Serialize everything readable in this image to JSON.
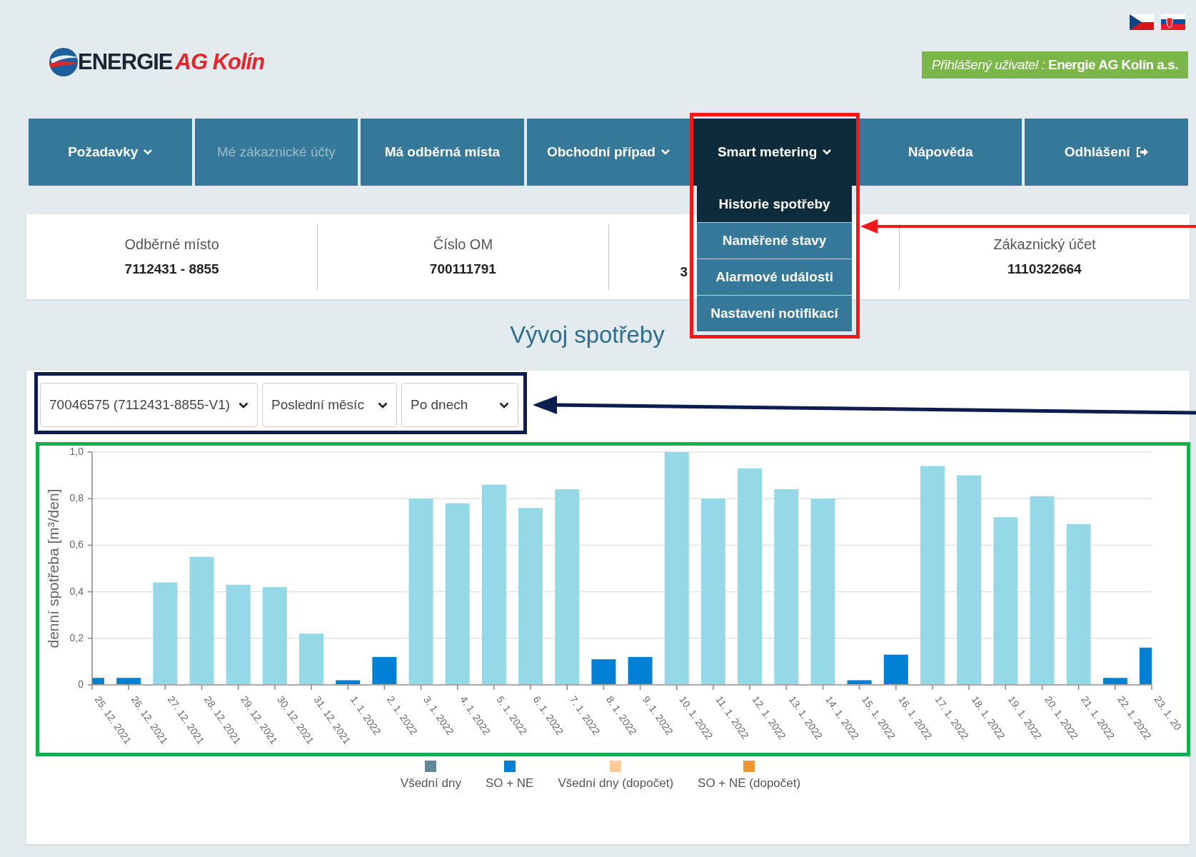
{
  "header": {
    "logo": {
      "brand": "ENERGIE",
      "city": "AG Kolín"
    },
    "user_badge": "*Přihlášený uživatel :* **Energie AG Kolín a.s.**"
  },
  "nav": [
    {
      "label": "Požadavky",
      "kind": "menu",
      "disabled": false,
      "selected": false
    },
    {
      "label": "Mé zákaznické účty",
      "kind": "link",
      "disabled": true,
      "selected": false
    },
    {
      "label": "Má odběrná místa",
      "kind": "link",
      "disabled": false,
      "selected": false
    },
    {
      "label": "Obchodní případ",
      "kind": "menu",
      "disabled": false,
      "selected": false
    },
    {
      "label": "Smart metering",
      "kind": "menu",
      "disabled": false,
      "selected": true,
      "submenu": [
        {
          "label": "Historie spotřeby",
          "selected": true
        },
        {
          "label": "Naměřené stavy",
          "selected": false
        },
        {
          "label": "Alarmové události",
          "selected": false
        },
        {
          "label": "Nastavení notifikací",
          "selected": false
        }
      ]
    },
    {
      "label": "Nápověda",
      "kind": "link",
      "disabled": false,
      "selected": false
    },
    {
      "label": "Odhlášení",
      "kind": "logout",
      "disabled": false,
      "selected": false
    }
  ],
  "info": [
    {
      "label": "Odběrné místo",
      "value": "7112431 - 8855"
    },
    {
      "label": "Číslo OM",
      "value": "700111791"
    },
    {
      "value": "3"
    },
    {
      "label": "Zákaznický účet",
      "value": "1110322664"
    }
  ],
  "section_title": "Vývoj spotřeby",
  "filters": [
    {
      "value": "70046575 (7112431-8855-V1)"
    },
    {
      "value": "Poslední měsíc"
    },
    {
      "value": "Po dnech"
    }
  ],
  "chart_data": {
    "type": "bar",
    "ylabel": "denní spotřeba [m³/den]",
    "stacked": true,
    "grid": true,
    "categories": [
      "25. 12. 2021",
      "26. 12. 2021",
      "27. 12. 2021",
      "28. 12. 2021",
      "29. 12. 2021",
      "30. 12. 2021",
      "31. 12. 2021",
      "1. 1. 2022",
      "2. 1. 2022",
      "3. 1. 2022",
      "4. 1. 2022",
      "5. 1. 2022",
      "6. 1. 2022",
      "7. 1. 2022",
      "8. 1. 2022",
      "9. 1. 2022",
      "10. 1. 2022",
      "11. 1. 2022",
      "12. 1. 2022",
      "13. 1. 2022",
      "14. 1. 2022",
      "15. 1. 2022",
      "16. 1. 2022",
      "17. 1. 2022",
      "18. 1. 2022",
      "19. 1. 2022",
      "20. 1. 2022",
      "21. 1. 2022",
      "22. 1. 2022",
      "23. 1. 20"
    ],
    "series": [
      {
        "name": "Všední dny",
        "color": "#95d9e8",
        "values": [
          null,
          null,
          0.44,
          0.55,
          0.43,
          0.42,
          0.22,
          null,
          null,
          0.8,
          0.78,
          0.86,
          0.76,
          0.84,
          null,
          null,
          1.0,
          0.8,
          0.93,
          0.84,
          0.8,
          null,
          null,
          0.94,
          0.9,
          0.72,
          0.81,
          0.69,
          null,
          null
        ]
      },
      {
        "name": "SO + NE",
        "color": "#0080d4",
        "values": [
          0.03,
          0.03,
          null,
          null,
          null,
          null,
          null,
          0.02,
          0.12,
          null,
          null,
          null,
          null,
          null,
          0.11,
          0.12,
          null,
          null,
          null,
          null,
          null,
          0.02,
          0.13,
          null,
          null,
          null,
          null,
          null,
          0.03,
          0.16
        ]
      }
    ],
    "ylim": [
      0,
      1
    ],
    "yticks": [
      {
        "value": 0,
        "label": "0"
      },
      {
        "value": 0.2,
        "label": "0,2"
      },
      {
        "value": 0.4,
        "label": "0,4"
      },
      {
        "value": 0.6,
        "label": "0,6"
      },
      {
        "value": 0.8,
        "label": "0,8"
      },
      {
        "value": 1,
        "label": "1,0"
      }
    ]
  },
  "legend": [
    {
      "color": "#5f8a96"
    },
    {
      "color": "#0080d4"
    },
    {
      "label": "Všední dny (dopočet)",
      "color": "#ffcc99"
    },
    {
      "label": "SO + NE (dopočet)",
      "color": "#eb9a33"
    }
  ]
}
